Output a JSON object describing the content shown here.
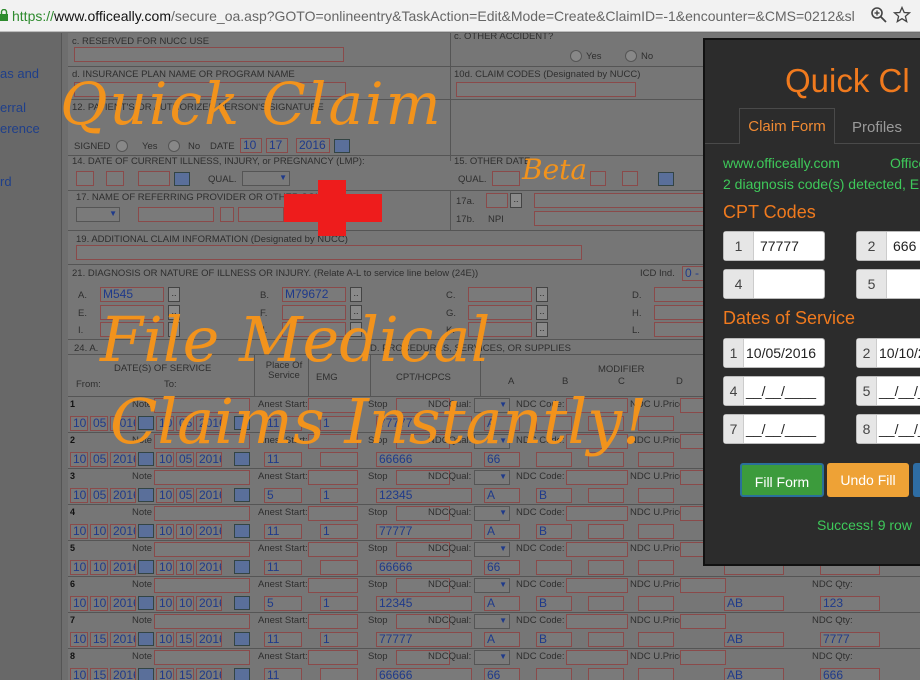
{
  "browser": {
    "url": "https://www.officeally.com/secure_oa.asp?GOTO=onlineentry&TaskAction=Edit&Mode=Create&ClaimID=-1&encounter=&CMS=0212&sl",
    "url_domain": "www.officeally.com",
    "url_scheme": "https://",
    "url_rest": "/secure_oa.asp?GOTO=onlineentry&TaskAction=Edit&Mode=Create&ClaimID=-1&encounter=&CMS=0212&sl"
  },
  "sidebar": {
    "items": [
      "as and",
      "erral",
      "erence",
      "rd"
    ]
  },
  "form": {
    "labels": {
      "reserved": "c. RESERVED FOR NUCC USE",
      "insurance": "d. INSURANCE PLAN NAME OR PROGRAM NAME",
      "claim_codes": "10d. CLAIM CODES (Designated by NUCC)",
      "other_accident": "c. OTHER ACCIDENT?",
      "yes": "Yes",
      "no": "No",
      "signature": "12. PATIENT'S OR AUTHORIZED PERSON'S SIGNATURE",
      "signed": "SIGNED",
      "date": "DATE",
      "date_value_month": "10",
      "date_value_day": "17",
      "date_value_year": "2016",
      "box14": "14. DATE OF CURRENT ILLNESS, INJURY, or PREGNANCY (LMP):",
      "box15": "15. OTHER DATE",
      "qual": "QUAL.",
      "box17": "17. NAME OF REFERRING PROVIDER OR OTHER SOURCE",
      "box17a": "17a.",
      "box17b": "17b.",
      "npi": "NPI",
      "box19": "19. ADDITIONAL CLAIM INFORMATION (Designated by NUCC)",
      "box21": "21. DIAGNOSIS OR NATURE OF ILLNESS OR INJURY. (Relate A-L to service line below (24E))",
      "icd_ind": "ICD Ind.",
      "icd_value": "0 -",
      "box24": "24. A.",
      "procedures": "D. PROCEDURES, SERVICES, OR SUPPLIES",
      "dates_of_service": "DATE(S) OF SERVICE",
      "from": "From:",
      "to": "To:",
      "place": "Place Of Service",
      "emg": "EMG",
      "cpt": "CPT/HCPCS",
      "modifier": "MODIFIER",
      "mods": [
        "A",
        "B",
        "C",
        "D"
      ],
      "note": "Note",
      "anest": "Anest Start:",
      "stop": "Stop",
      "ndcqual": "NDCQual:",
      "ndccode": "NDC Code:",
      "ndcuprice": "NDC U.Price:",
      "ndcqty": "NDC Qty:"
    },
    "diagnosis": [
      {
        "letter": "A.",
        "code": "M545"
      },
      {
        "letter": "B.",
        "code": "M79672"
      },
      {
        "letter": "C.",
        "code": ""
      },
      {
        "letter": "D.",
        "code": ""
      },
      {
        "letter": "E.",
        "code": ""
      },
      {
        "letter": "F.",
        "code": ""
      },
      {
        "letter": "G.",
        "code": ""
      },
      {
        "letter": "H.",
        "code": ""
      },
      {
        "letter": "I.",
        "code": ""
      },
      {
        "letter": "J.",
        "code": ""
      },
      {
        "letter": "K.",
        "code": ""
      },
      {
        "letter": "L.",
        "code": ""
      }
    ],
    "service_lines": [
      {
        "num": "1",
        "fm": "10",
        "fd": "05",
        "fy": "2016",
        "tm": "10",
        "td": "05",
        "ty": "2016",
        "pos": "11",
        "units": "1",
        "cpt": "77777",
        "ptr": "A",
        "ptr2": "",
        "extra": "",
        "extra2": ""
      },
      {
        "num": "2",
        "fm": "10",
        "fd": "05",
        "fy": "2016",
        "tm": "10",
        "td": "05",
        "ty": "2016",
        "pos": "11",
        "units": "",
        "cpt": "66666",
        "ptr": "66",
        "ptr2": "",
        "extra": "",
        "extra2": ""
      },
      {
        "num": "3",
        "fm": "10",
        "fd": "05",
        "fy": "2016",
        "tm": "10",
        "td": "05",
        "ty": "2016",
        "pos": "5",
        "units": "1",
        "cpt": "12345",
        "ptr": "A",
        "ptr2": "B",
        "extra": "",
        "extra2": ""
      },
      {
        "num": "4",
        "fm": "10",
        "fd": "10",
        "fy": "2016",
        "tm": "10",
        "td": "10",
        "ty": "2016",
        "pos": "11",
        "units": "1",
        "cpt": "77777",
        "ptr": "A",
        "ptr2": "B",
        "extra": "",
        "extra2": ""
      },
      {
        "num": "5",
        "fm": "10",
        "fd": "10",
        "fy": "2016",
        "tm": "10",
        "td": "10",
        "ty": "2016",
        "pos": "11",
        "units": "",
        "cpt": "66666",
        "ptr": "66",
        "ptr2": "",
        "extra": "",
        "extra2": ""
      },
      {
        "num": "6",
        "fm": "10",
        "fd": "10",
        "fy": "2016",
        "tm": "10",
        "td": "10",
        "ty": "2016",
        "pos": "5",
        "units": "1",
        "cpt": "12345",
        "ptr": "A",
        "ptr2": "B",
        "extra": "AB",
        "extra2": "123"
      },
      {
        "num": "7",
        "fm": "10",
        "fd": "15",
        "fy": "2016",
        "tm": "10",
        "td": "15",
        "ty": "2016",
        "pos": "11",
        "units": "1",
        "cpt": "77777",
        "ptr": "A",
        "ptr2": "B",
        "extra": "AB",
        "extra2": "7777"
      },
      {
        "num": "8",
        "fm": "10",
        "fd": "15",
        "fy": "2016",
        "tm": "10",
        "td": "15",
        "ty": "2016",
        "pos": "11",
        "units": "",
        "cpt": "66666",
        "ptr": "66",
        "ptr2": "",
        "extra": "AB",
        "extra2": "666"
      }
    ]
  },
  "overlay": {
    "title": "Quick Claim",
    "beta": "Beta",
    "tagline1": "File Medical",
    "tagline2": "Claims Instantly!"
  },
  "panel": {
    "title": "Quick Cl",
    "tabs": {
      "claim_form": "Claim Form",
      "profiles": "Profiles"
    },
    "site": "www.officeally.com",
    "site2": "Office",
    "detected": "2 diagnosis code(s) detected, E",
    "cpt_heading": "CPT Codes",
    "cpt": [
      {
        "n": "1",
        "v": "77777"
      },
      {
        "n": "2",
        "v": "666"
      },
      {
        "n": "4",
        "v": ""
      },
      {
        "n": "5",
        "v": ""
      }
    ],
    "dates_heading": "Dates of Service",
    "dates": [
      {
        "n": "1",
        "v": "10/05/2016"
      },
      {
        "n": "2",
        "v": "10/10/2"
      },
      {
        "n": "4",
        "v": "__/__/____"
      },
      {
        "n": "5",
        "v": "__/__/__"
      },
      {
        "n": "7",
        "v": "__/__/____"
      },
      {
        "n": "8",
        "v": "__/__/__"
      }
    ],
    "btn_fill": "Fill Form",
    "btn_undo": "Undo Fill",
    "success": "Success! 9 row",
    "colors": {
      "accent": "#f07a1e",
      "green": "#3ec95a",
      "fill_btn": "#3c9b3c",
      "undo_btn": "#eea236",
      "third_btn": "#2e6da4"
    }
  }
}
